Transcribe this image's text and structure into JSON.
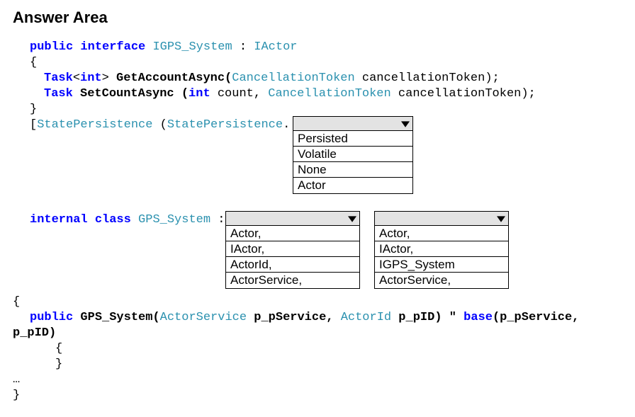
{
  "heading": "Answer Area",
  "code": {
    "l1_kw_public": "public",
    "l1_kw_interface": "interface",
    "l1_type_igps": "IGPS_System",
    "l1_colon": " : ",
    "l1_type_iactor": "IActor",
    "l2_brace_open": "{",
    "l3_kw_task": "Task",
    "l3_lt": "<",
    "l3_kw_int": "int",
    "l3_gt": "> ",
    "l3_method": "GetAccountAsync(",
    "l3_type_ct": "CancellationToken",
    "l3_param": " cancellationToken);",
    "l4_kw_task": "Task",
    "l4_method": " SetCountAsync (",
    "l4_kw_int": "int",
    "l4_count": " count, ",
    "l4_type_ct": "CancellationToken",
    "l4_param": " cancellationToken);",
    "l5_brace_close": "}",
    "sp_attr_open": "[",
    "sp_attr_type1": "StatePersistence",
    "sp_attr_space": " (",
    "sp_attr_type2": "StatePersistence",
    "sp_attr_dot": ".",
    "cls_kw_internal": "internal",
    "cls_kw_class": "class",
    "cls_type": "GPS_System",
    "cls_colon": " : ",
    "ctor_brace_open": "{",
    "ctor_kw_public": "public",
    "ctor_name": " GPS_System(",
    "ctor_t1": "ActorService",
    "ctor_p1": " p_pService, ",
    "ctor_t2": "ActorId",
    "ctor_p2": " p_pID) \" ",
    "ctor_kw_base": "base",
    "ctor_tail1": "(p_pService,",
    "ctor_tail2": "p_pID)",
    "ctor_brace2_open": "{",
    "ctor_brace2_close": "}",
    "ellipsis": "…",
    "final_close": "}"
  },
  "dropdowns": {
    "statePersistence": {
      "options": [
        "Persisted",
        "Volatile",
        "None",
        "Actor"
      ]
    },
    "baseClass": {
      "options": [
        "Actor,",
        "IActor,",
        "ActorId,",
        "ActorService,"
      ]
    },
    "iface": {
      "options": [
        "Actor,",
        "IActor,",
        "IGPS_System",
        "ActorService,"
      ]
    }
  }
}
